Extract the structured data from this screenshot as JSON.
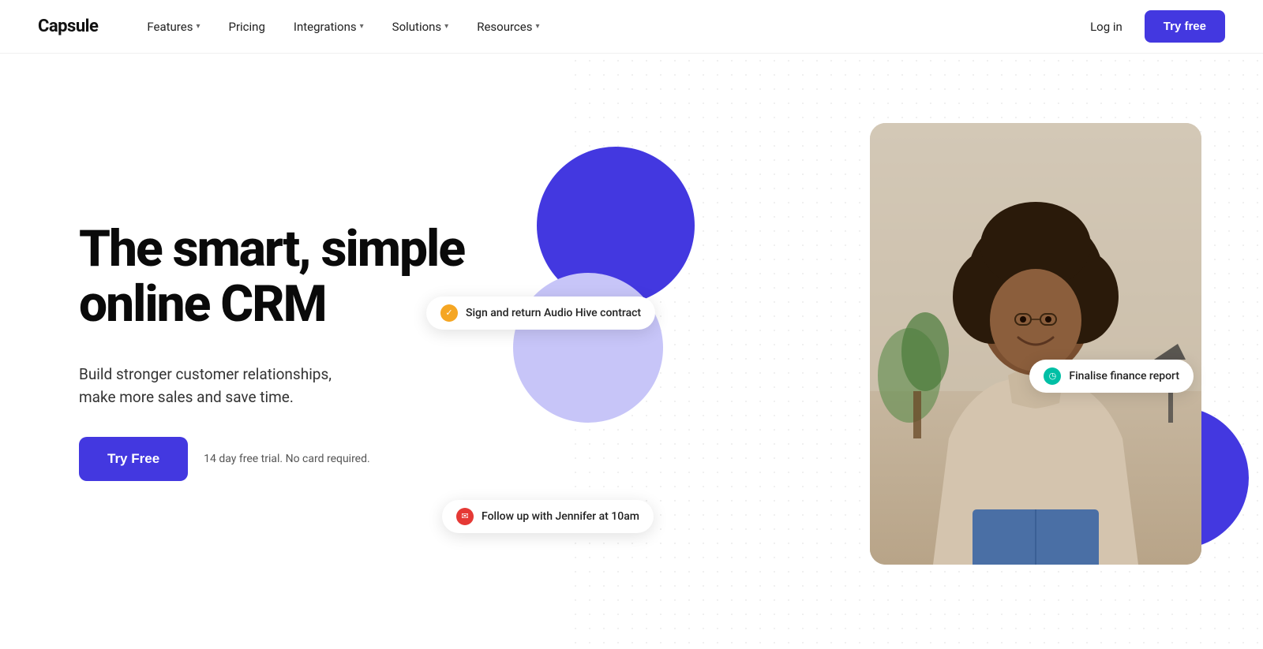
{
  "brand": {
    "name": "Capsule"
  },
  "nav": {
    "links": [
      {
        "label": "Features",
        "has_dropdown": true
      },
      {
        "label": "Pricing",
        "has_dropdown": false
      },
      {
        "label": "Integrations",
        "has_dropdown": true
      },
      {
        "label": "Solutions",
        "has_dropdown": true
      },
      {
        "label": "Resources",
        "has_dropdown": true
      }
    ],
    "login_label": "Log in",
    "try_free_label": "Try free"
  },
  "hero": {
    "title": "The smart, simple online CRM",
    "subtitle_line1": "Build stronger customer relationships,",
    "subtitle_line2": "make more sales and save time.",
    "cta_button": "Try Free",
    "trial_note": "14 day free trial. No card required.",
    "badges": [
      {
        "id": "badge-1",
        "icon_type": "gold",
        "icon_symbol": "✓",
        "text": "Sign and return Audio Hive contract"
      },
      {
        "id": "badge-2",
        "icon_type": "teal",
        "icon_symbol": "◷",
        "text": "Finalise finance report"
      },
      {
        "id": "badge-3",
        "icon_type": "red",
        "icon_symbol": "✉",
        "text": "Follow up with Jennifer at 10am"
      }
    ]
  },
  "colors": {
    "brand_purple": "#4338e0",
    "lavender": "#c7c5f8",
    "accent_gold": "#f5a623",
    "accent_teal": "#00bfa5",
    "accent_red": "#e53935"
  }
}
